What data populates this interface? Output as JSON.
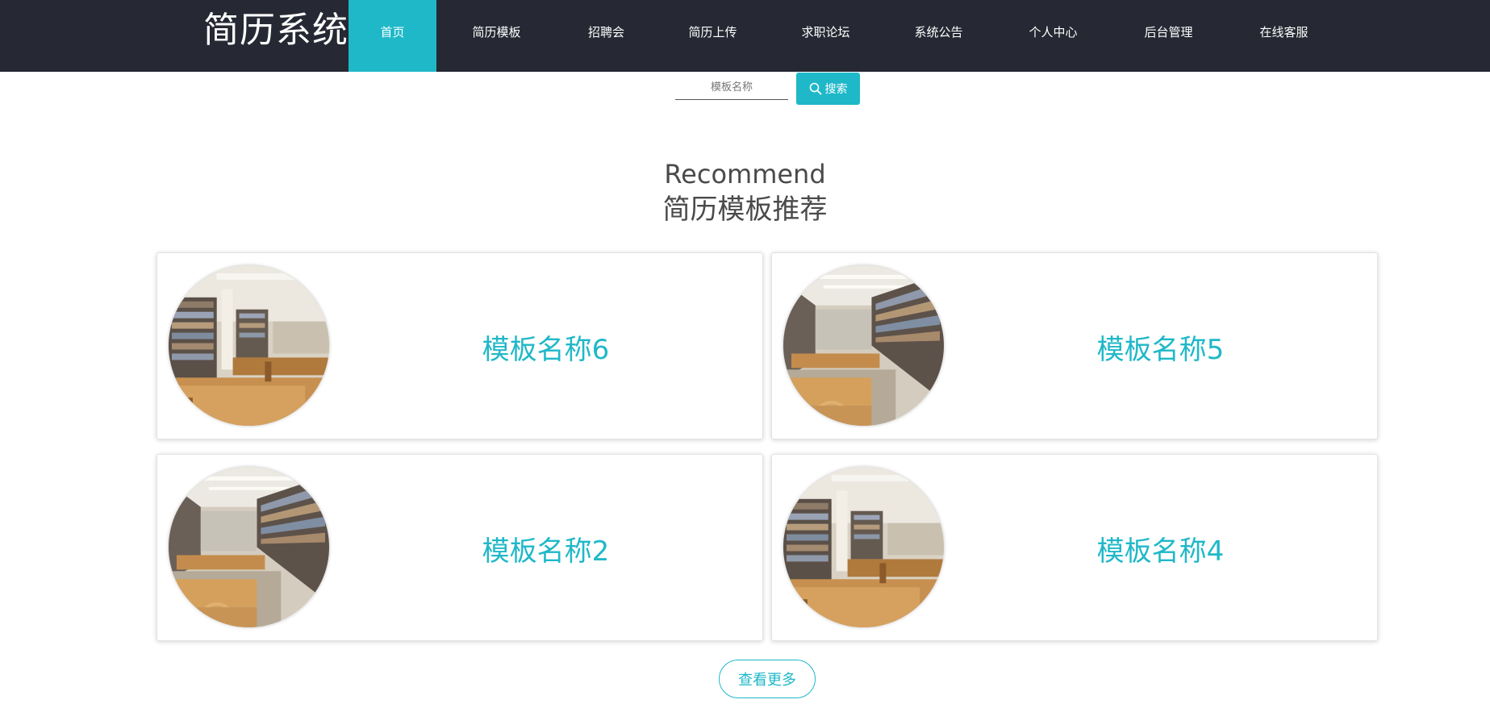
{
  "header": {
    "brand": "简历系统",
    "nav": [
      {
        "label": "首页",
        "active": true
      },
      {
        "label": "简历模板",
        "active": false
      },
      {
        "label": "招聘会",
        "active": false
      },
      {
        "label": "简历上传",
        "active": false
      },
      {
        "label": "求职论坛",
        "active": false
      },
      {
        "label": "系统公告",
        "active": false
      },
      {
        "label": "个人中心",
        "active": false
      },
      {
        "label": "后台管理",
        "active": false
      },
      {
        "label": "在线客服",
        "active": false
      }
    ]
  },
  "search": {
    "placeholder": "模板名称",
    "value": "",
    "button_label": "搜索",
    "button_icon": "search-icon"
  },
  "recommend": {
    "title_en": "Recommend",
    "title_cn": "简历模板推荐",
    "items": [
      {
        "name": "模板名称6",
        "image": "library-photo-a"
      },
      {
        "name": "模板名称5",
        "image": "library-photo-b"
      },
      {
        "name": "模板名称2",
        "image": "library-photo-b"
      },
      {
        "name": "模板名称4",
        "image": "library-photo-a"
      }
    ],
    "more_label": "查看更多"
  },
  "colors": {
    "header_bg": "#262833",
    "accent": "#1fb8c8",
    "title_text": "#4a4a4a"
  }
}
